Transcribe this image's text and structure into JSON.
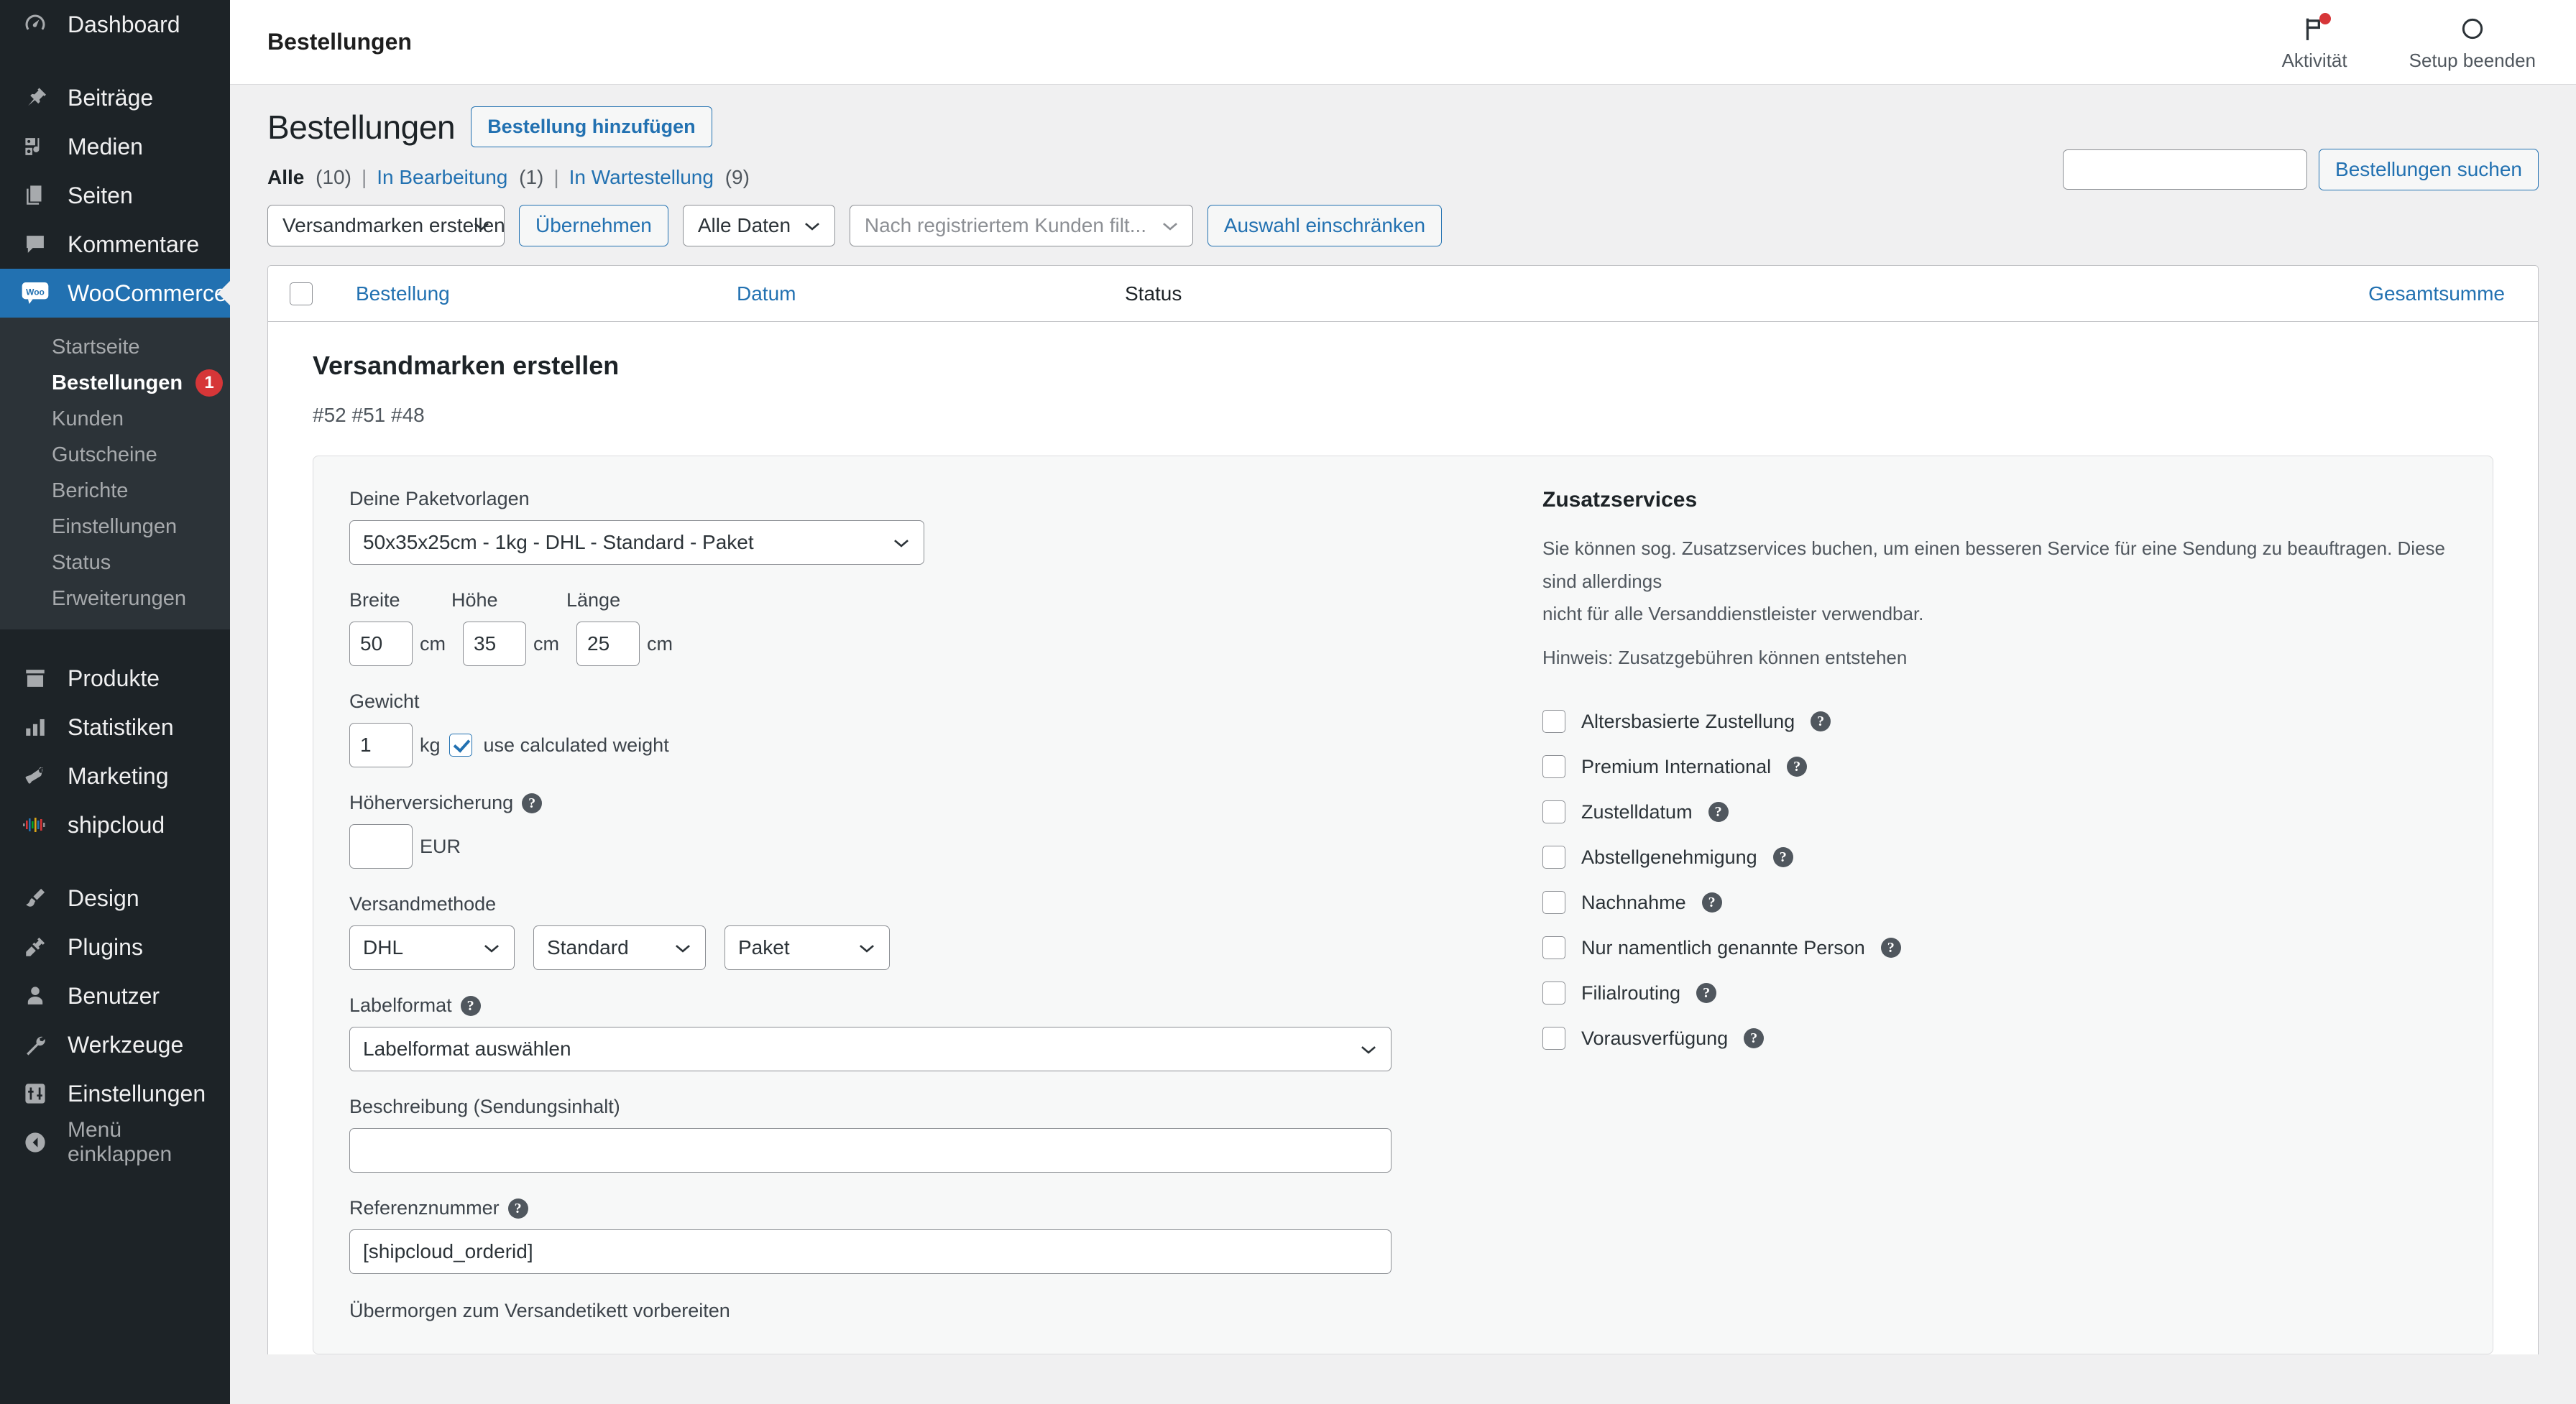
{
  "sidebar": {
    "items": [
      {
        "label": "Dashboard",
        "icon": "dashboard-icon"
      },
      {
        "label": "Beiträge",
        "icon": "pin-icon"
      },
      {
        "label": "Medien",
        "icon": "media-icon"
      },
      {
        "label": "Seiten",
        "icon": "pages-icon"
      },
      {
        "label": "Kommentare",
        "icon": "comment-icon"
      },
      {
        "label": "WooCommerce",
        "icon": "woo-icon"
      },
      {
        "label": "Produkte",
        "icon": "product-box-icon"
      },
      {
        "label": "Statistiken",
        "icon": "bar-chart-icon"
      },
      {
        "label": "Marketing",
        "icon": "megaphone-icon"
      },
      {
        "label": "shipcloud",
        "icon": "shipcloud-icon"
      },
      {
        "label": "Design",
        "icon": "paintbrush-icon"
      },
      {
        "label": "Plugins",
        "icon": "plug-icon"
      },
      {
        "label": "Benutzer",
        "icon": "user-icon"
      },
      {
        "label": "Werkzeuge",
        "icon": "wrench-icon"
      },
      {
        "label": "Einstellungen",
        "icon": "sliders-icon"
      },
      {
        "label": "Menü einklappen",
        "icon": "collapse-arrow-icon"
      }
    ],
    "woo_submenu": [
      {
        "label": "Startseite",
        "badge": ""
      },
      {
        "label": "Bestellungen",
        "badge": "1"
      },
      {
        "label": "Kunden",
        "badge": ""
      },
      {
        "label": "Gutscheine",
        "badge": ""
      },
      {
        "label": "Berichte",
        "badge": ""
      },
      {
        "label": "Einstellungen",
        "badge": ""
      },
      {
        "label": "Status",
        "badge": ""
      },
      {
        "label": "Erweiterungen",
        "badge": ""
      }
    ],
    "accent_color": "#2271b1",
    "badge_color": "#d63638"
  },
  "topbar": {
    "title": "Bestellungen",
    "activity_label": "Aktivität",
    "setup_label": "Setup beenden"
  },
  "page": {
    "title": "Bestellungen",
    "add_order_label": "Bestellung hinzufügen",
    "filters": [
      {
        "label": "Alle",
        "count": "(10)",
        "current": true
      },
      {
        "label": "In Bearbeitung",
        "count": "(1)",
        "current": false
      },
      {
        "label": "In Wartestellung",
        "count": "(9)",
        "current": false
      }
    ],
    "separator": "|"
  },
  "tablenav": {
    "bulk_action": "Versandmarken erstellen",
    "apply_label": "Übernehmen",
    "date_filter": "Alle Daten",
    "customer_filter_placeholder": "Nach registriertem Kunden filt...",
    "restrict_label": "Auswahl einschränken",
    "search_value": "",
    "search_button": "Bestellungen suchen"
  },
  "table": {
    "columns": [
      {
        "label": "Bestellung",
        "sortable": true
      },
      {
        "label": "Datum",
        "sortable": true
      },
      {
        "label": "Status",
        "sortable": false
      },
      {
        "label": "Gesamtsumme",
        "sortable": true
      }
    ]
  },
  "label_panel": {
    "title": "Versandmarken erstellen",
    "orders": "#52 #51 #48",
    "package_templates_label": "Deine Paketvorlagen",
    "package_template_value": "50x35x25cm - 1kg - DHL - Standard - Paket",
    "width_label": "Breite",
    "width_value": "50",
    "height_label": "Höhe",
    "height_value": "35",
    "length_label": "Länge",
    "length_value": "25",
    "cm_unit": "cm",
    "weight_label": "Gewicht",
    "weight_value": "1",
    "kg_unit": "kg",
    "use_calculated_weight_label": "use calculated weight",
    "use_calculated_weight_checked": true,
    "insurance_label": "Höherversicherung",
    "insurance_value": "",
    "eur_unit": "EUR",
    "shipping_method_label": "Versandmethode",
    "carrier_value": "DHL",
    "service_value": "Standard",
    "package_type_value": "Paket",
    "labelformat_label": "Labelformat",
    "labelformat_value": "Labelformat auswählen",
    "description_label": "Beschreibung (Sendungsinhalt)",
    "description_value": "",
    "reference_label": "Referenznummer",
    "reference_value": "[shipcloud_orderid]",
    "cut_off_label": "Übermorgen zum Versandetikett vorbereiten",
    "help_glyph": "?"
  },
  "additional_services": {
    "title": "Zusatzservices",
    "description_line1": "Sie können sog. Zusatzservices buchen, um einen besseren Service für eine Sendung zu beauftragen. Diese sind allerdings",
    "description_line2": "nicht für alle Versanddienstleister verwendbar.",
    "note": "Hinweis: Zusatzgebühren können entstehen",
    "services": [
      {
        "label": "Altersbasierte Zustellung",
        "checked": false
      },
      {
        "label": "Premium International",
        "checked": false
      },
      {
        "label": "Zustelldatum",
        "checked": false
      },
      {
        "label": "Abstellgenehmigung",
        "checked": false
      },
      {
        "label": "Nachnahme",
        "checked": false
      },
      {
        "label": "Nur namentlich genannte Person",
        "checked": false
      },
      {
        "label": "Filialrouting",
        "checked": false
      },
      {
        "label": "Vorausverfügung",
        "checked": false
      }
    ]
  }
}
